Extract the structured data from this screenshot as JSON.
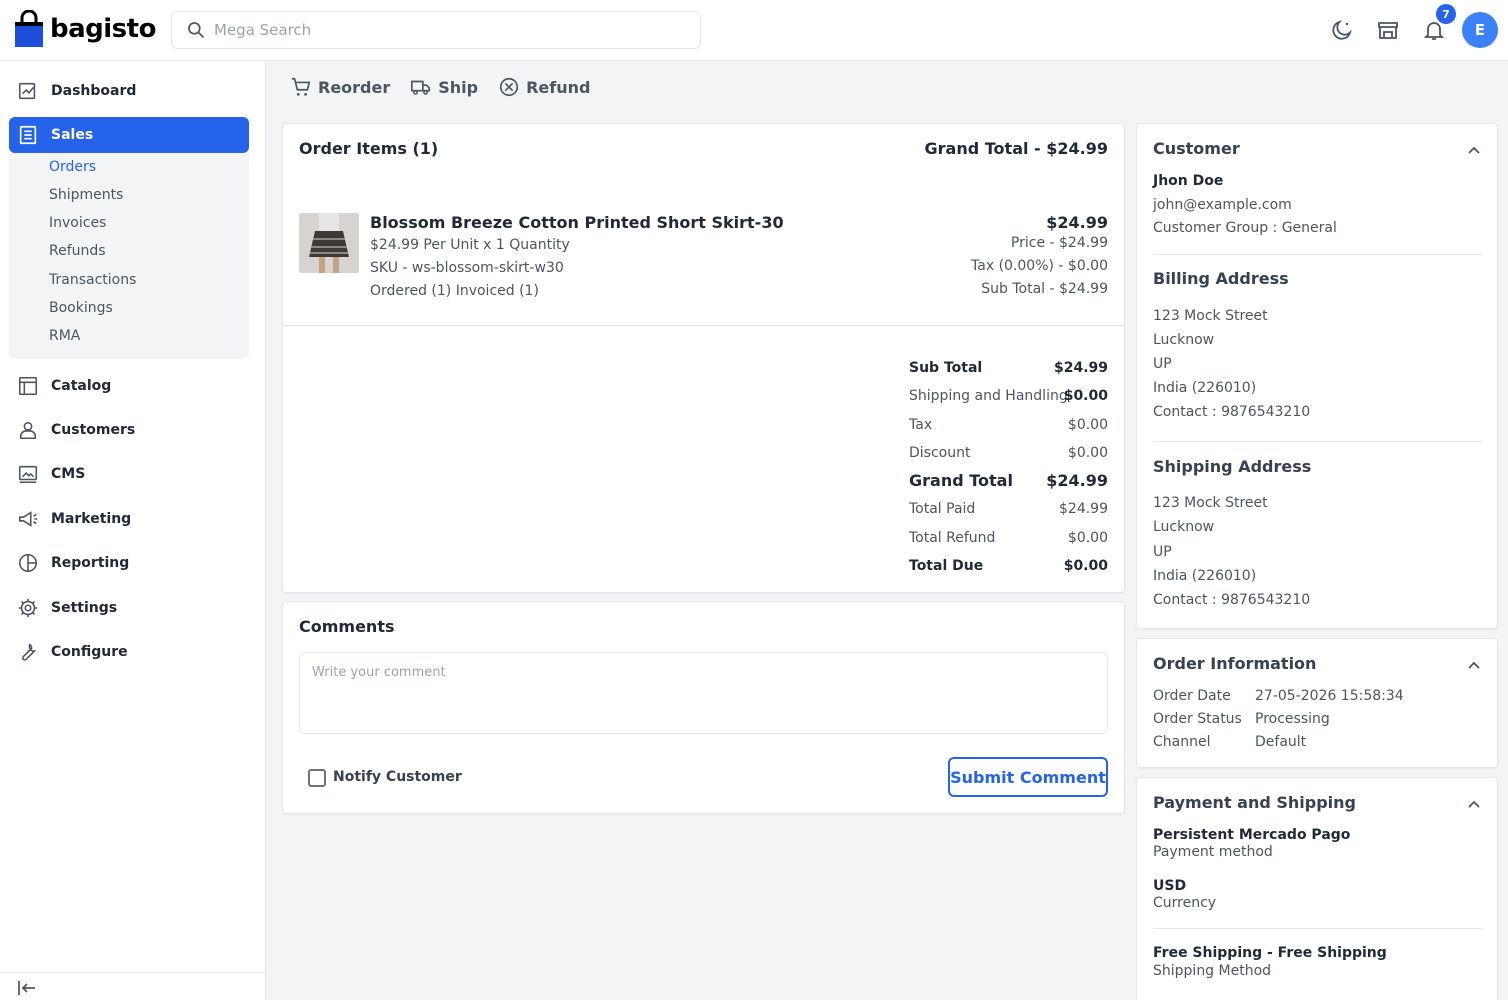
{
  "header": {
    "brand": "bagisto",
    "search_placeholder": "Mega Search",
    "notification_count": "7",
    "avatar_initial": "E"
  },
  "sidebar": {
    "items": [
      {
        "label": "Dashboard",
        "icon": "dashboard-icon"
      },
      {
        "label": "Sales",
        "icon": "sales-icon"
      },
      {
        "label": "Catalog",
        "icon": "catalog-icon"
      },
      {
        "label": "Customers",
        "icon": "customers-icon"
      },
      {
        "label": "CMS",
        "icon": "cms-icon"
      },
      {
        "label": "Marketing",
        "icon": "marketing-icon"
      },
      {
        "label": "Reporting",
        "icon": "reporting-icon"
      },
      {
        "label": "Settings",
        "icon": "settings-icon"
      },
      {
        "label": "Configure",
        "icon": "configure-icon"
      }
    ],
    "sales_sub": [
      "Orders",
      "Shipments",
      "Invoices",
      "Refunds",
      "Transactions",
      "Bookings",
      "RMA"
    ]
  },
  "actions": {
    "reorder": "Reorder",
    "ship": "Ship",
    "refund": "Refund"
  },
  "order_items": {
    "title": "Order Items (1)",
    "grand_total_label": "Grand Total - $24.99",
    "item": {
      "name": "Blossom Breeze Cotton Printed Short Skirt-30",
      "unit_line": "$24.99 Per Unit x 1 Quantity",
      "sku": "SKU - ws-blossom-skirt-w30",
      "status_line": "Ordered (1) Invoiced (1)",
      "price_total": "$24.99",
      "price": "Price - $24.99",
      "tax": "Tax (0.00%) - $0.00",
      "sub_total": "Sub Total - $24.99"
    },
    "summary": [
      {
        "label": "Sub Total",
        "value": "$24.99",
        "style": "bold"
      },
      {
        "label": "Shipping and Handling",
        "value": "$0.00",
        "style": "normal-boldval"
      },
      {
        "label": "Tax",
        "value": "$0.00",
        "style": "normal"
      },
      {
        "label": "Discount",
        "value": "$0.00",
        "style": "normal"
      },
      {
        "label": "Grand Total",
        "value": "$24.99",
        "style": "large"
      },
      {
        "label": "Total Paid",
        "value": "$24.99",
        "style": "normal"
      },
      {
        "label": "Total Refund",
        "value": "$0.00",
        "style": "normal"
      },
      {
        "label": "Total Due",
        "value": "$0.00",
        "style": "bold"
      }
    ]
  },
  "comments": {
    "title": "Comments",
    "placeholder": "Write your comment",
    "notify_label": "Notify Customer",
    "submit_label": "Submit Comment"
  },
  "customer": {
    "title": "Customer",
    "name": "Jhon Doe",
    "email": "john@example.com",
    "group": "Customer Group : General"
  },
  "billing": {
    "title": "Billing Address",
    "lines": [
      "123 Mock Street",
      "Lucknow",
      "UP",
      "India (226010)",
      "Contact : 9876543210"
    ]
  },
  "shipping": {
    "title": "Shipping Address",
    "lines": [
      "123 Mock Street",
      "Lucknow",
      "UP",
      "India (226010)",
      "Contact : 9876543210"
    ]
  },
  "order_info": {
    "title": "Order Information",
    "rows": [
      {
        "label": "Order Date",
        "value": "27-05-2026 15:58:34"
      },
      {
        "label": "Order Status",
        "value": "Processing"
      },
      {
        "label": "Channel",
        "value": "Default"
      }
    ]
  },
  "payment": {
    "title": "Payment and Shipping",
    "method_name": "Persistent Mercado Pago",
    "method_label": "Payment method",
    "currency": "USD",
    "currency_label": "Currency",
    "shipping_name": "Free Shipping - Free Shipping",
    "shipping_label": "Shipping Method"
  }
}
